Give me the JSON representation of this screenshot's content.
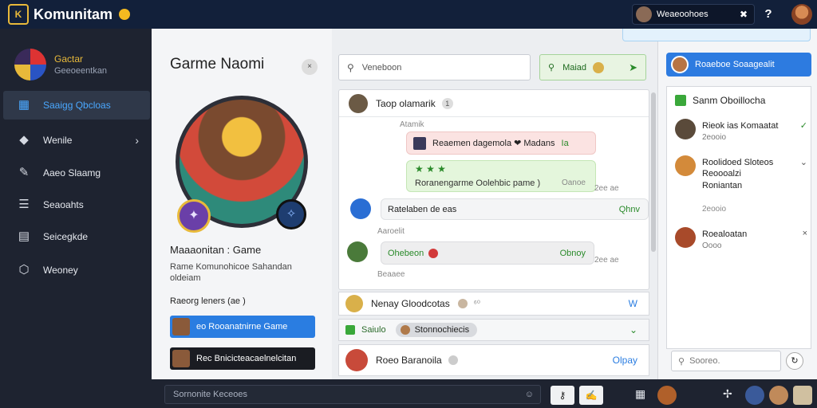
{
  "app": {
    "title": "Komunitam"
  },
  "topbar": {
    "user_label": "Weaeoohoes",
    "close_glyph": "✖",
    "help_glyph": "?"
  },
  "sidebar": {
    "profile_name": "Gactar",
    "profile_sub": "Geeoeentkan",
    "items": [
      {
        "label": "Saaigg Qbcloas",
        "icon": "grid-icon",
        "glyph": "▦",
        "active": true
      },
      {
        "label": "Wenile",
        "icon": "shield-icon",
        "glyph": "◆"
      },
      {
        "label": "Aaeo Slaamg",
        "icon": "edit-icon",
        "glyph": "✎"
      },
      {
        "label": "Seaoahts",
        "icon": "list-icon",
        "glyph": "☰"
      },
      {
        "label": "Seicegkde",
        "icon": "calendar-icon",
        "glyph": "▤"
      },
      {
        "label": "Weoney",
        "icon": "hexagon-icon",
        "glyph": "⬡"
      }
    ]
  },
  "profile": {
    "title": "Garme Naomi",
    "close_glyph": "×",
    "name": "Maaaonitan : Game",
    "desc": "Rame Komunohicoe Sahandan oldeiam",
    "tags": "Raeorg leners (ae )",
    "btn_primary": "eo Rooanatnirne Game",
    "btn_secondary": "Rec Bnicicteacaelnelcitan"
  },
  "chat": {
    "search_placeholder": "Veneboon",
    "action_label": "Maiad",
    "header_name": "Taop olamarik",
    "header_count": "1",
    "label1": "Atamik",
    "msg_pink": "Reaemen dagemola ❤ Madans",
    "msg_pink_tag": "Ia",
    "msg_green_top": "★ ★ ★",
    "msg_green_text": "Roranengarme Oolehbic pame )",
    "msg_green_tag": "Oanoe",
    "msg_green_time": "2ee ae",
    "msg_gray1": "Ratelaben de eas",
    "msg_gray1_tag": "Qhnv",
    "label2": "Aaroelit",
    "msg_gray2": "Ohebeon",
    "msg_gray2_tag": "Obnoy",
    "msg_gray2_time": "2ee ae",
    "label3": "Beaaee",
    "thread1_title": "Nenay Gloodcotas",
    "thread1_extra": "⁶⁰",
    "thread1_tag": "W",
    "thread2_label": "Saiulo",
    "thread2_chip": "Stonnochiecis",
    "thread3_title": "Roeo Baranoila",
    "thread3_tag": "Olpay"
  },
  "rightpanel": {
    "header": "Roaeboe Soaagealit",
    "section": "Sanm Oboillocha",
    "items": [
      {
        "title": "Rieok ias Komaatat",
        "sub": "2eooio",
        "meta": "✓"
      },
      {
        "title": "Roolidoed Sloteos Reoooalzi",
        "sub": "Roniantan",
        "meta": "⌄"
      },
      {
        "title": "Roealoatan",
        "sub": "Oooo",
        "meta": "×"
      }
    ],
    "item3_sub2": "2eooio",
    "search_placeholder": "Sooreo."
  },
  "bottombar": {
    "input_placeholder": "Sornonite Keceoes"
  }
}
